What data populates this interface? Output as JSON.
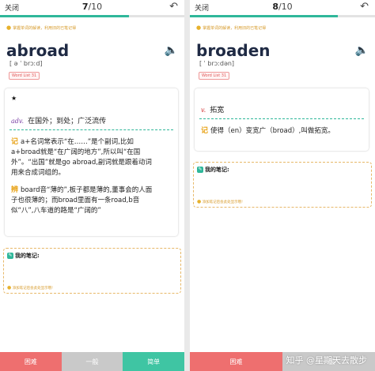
{
  "left": {
    "close_label": "关闭",
    "counter_current": "7",
    "counter_total": "/10",
    "progress": 0.7,
    "tip": "掌握单词的解读，利用旧的已笔记得",
    "word": "abroad",
    "phonetic": "[ ə ˈ brɔːd]",
    "badge": "Word List 31",
    "definition": {
      "pos": "adv.",
      "meaning": "在国外；到处；广泛流传"
    },
    "memo_tag": "记",
    "memo_lines": [
      "a+名词常表示“在……”是个副词,比如",
      "a+broad就是“在广阔的地方”,所以叫“在国",
      "外”。“出国”就是go abroad,副词就是跟着动词",
      "用来合成词组的。"
    ],
    "diff_tag": "辨",
    "diff_lines": [
      "board音“薄的”,板子都是薄的,董事会的人面",
      "子也很薄的；而broad里面有一条road,b音",
      "似“八”,八车道的路是“广阔的”"
    ],
    "notes_title": "我的笔记:",
    "notes_hint": "添加笔记后会此处显示哦!"
  },
  "right": {
    "close_label": "关闭",
    "counter_current": "8",
    "counter_total": "/10",
    "progress": 0.8,
    "tip": "掌握单词的解读，利用旧的已笔记得",
    "word": "broaden",
    "phonetic": "[ ˈ brɔːdən]",
    "badge": "Word List 31",
    "definition": {
      "pos": "v.",
      "meaning": "拓宽"
    },
    "memo_tag": "记",
    "memo_lines": [
      "使得（en）变宽广（broad）,叫做拓宽。"
    ],
    "notes_title": "我的笔记:",
    "notes_hint": "添加笔记后会此处显示哦!"
  },
  "footer": {
    "hard": "困难",
    "mid": "一般",
    "easy": "简单",
    "hard2": "困难",
    "mid2": "一般"
  },
  "watermark": "知乎 @星期天去散步",
  "colors": {
    "accent": "#2fb79a",
    "hard": "#ee6f6f",
    "mid": "#c9c9c9",
    "easy": "#3fc5a3",
    "tip": "#d79b2b"
  },
  "icons": {
    "back": "undo-arrow-icon",
    "speaker": "speaker-icon",
    "bulb": "lightbulb-icon",
    "note": "note-icon"
  }
}
